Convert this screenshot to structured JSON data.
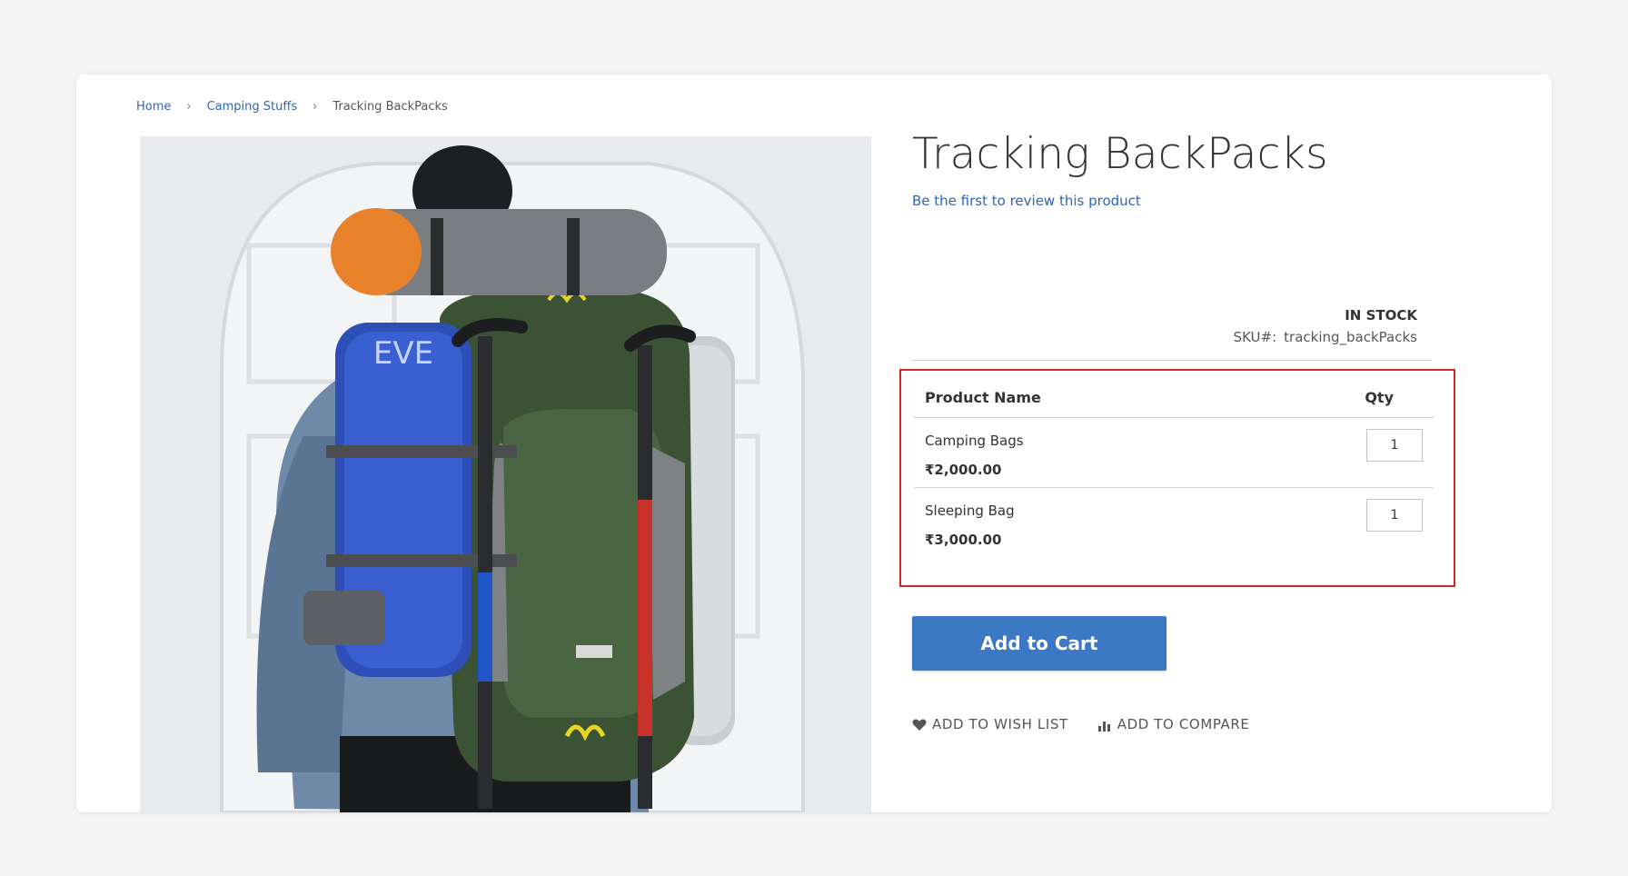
{
  "breadcrumb": {
    "home": "Home",
    "category": "Camping Stuffs",
    "current": "Tracking BackPacks",
    "separator": "›"
  },
  "product": {
    "title": "Tracking BackPacks",
    "review_link": "Be the first to review this product",
    "stock": "IN STOCK",
    "sku_label": "SKU#:",
    "sku_value": "tracking_backPacks",
    "image_icon": "product-photo-backpack"
  },
  "grouped_table": {
    "header_name": "Product Name",
    "header_qty": "Qty",
    "items": [
      {
        "name": "Camping Bags",
        "price": "₹2,000.00",
        "qty": "1"
      },
      {
        "name": "Sleeping Bag",
        "price": "₹3,000.00",
        "qty": "1"
      }
    ],
    "highlight_color": "#d1272c"
  },
  "cart": {
    "add_label": "Add to Cart",
    "button_color": "#3d78c4"
  },
  "actions": {
    "wishlist_label": "ADD TO WISH LIST",
    "wishlist_icon": "heart-icon",
    "compare_label": "ADD TO COMPARE",
    "compare_icon": "bar-chart-icon"
  },
  "colors": {
    "link": "#2b66b8",
    "background": "#f5f5f6"
  }
}
